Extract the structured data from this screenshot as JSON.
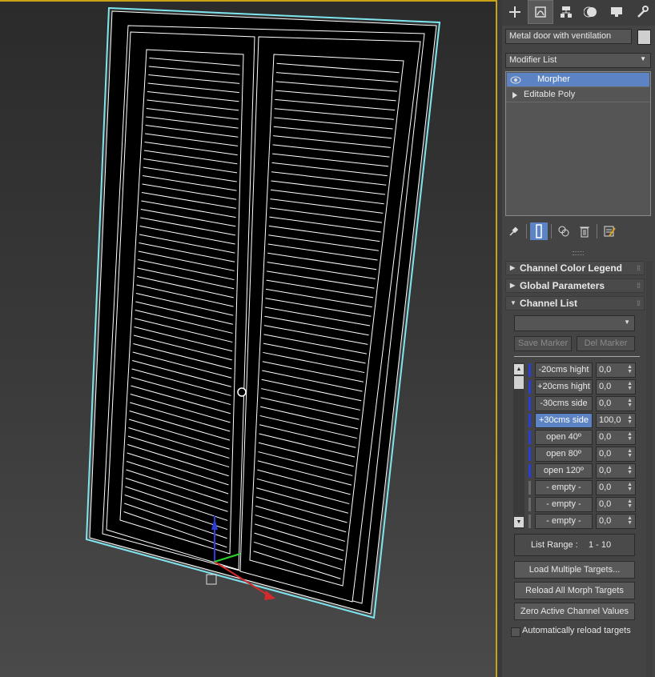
{
  "command_panel": {
    "tabs": [
      {
        "icon": "create-plus-icon"
      },
      {
        "icon": "modify-icon",
        "active": true
      },
      {
        "icon": "hierarchy-icon"
      },
      {
        "icon": "motion-icon"
      },
      {
        "icon": "display-icon"
      },
      {
        "icon": "utilities-wrench-icon"
      }
    ],
    "object_name": "Metal door with ventilation",
    "object_color": "#cfcfcf",
    "modifier_list_label": "Modifier List",
    "stack": [
      {
        "label": "Morpher",
        "selected": true
      },
      {
        "label": "Editable Poly",
        "selected": false
      }
    ],
    "rollouts": {
      "channel_color_legend": "Channel Color Legend",
      "global_parameters": "Global Parameters",
      "channel_list": "Channel List"
    },
    "marker_dropdown_value": "",
    "save_marker": "Save Marker",
    "del_marker": "Del Marker",
    "channels": [
      {
        "name": "-20cms hight",
        "value": "0,0",
        "color": "#2b3fd6",
        "selected": false
      },
      {
        "name": "+20cms hight",
        "value": "0,0",
        "color": "#2b3fd6",
        "selected": false
      },
      {
        "name": "-30cms side",
        "value": "0,0",
        "color": "#2b3fd6",
        "selected": false
      },
      {
        "name": "+30cms side",
        "value": "100,0",
        "color": "#2b3fd6",
        "selected": true
      },
      {
        "name": "open 40º",
        "value": "0,0",
        "color": "#2b3fd6",
        "selected": false
      },
      {
        "name": "open 80º",
        "value": "0,0",
        "color": "#2b3fd6",
        "selected": false
      },
      {
        "name": "open 120º",
        "value": "0,0",
        "color": "#2b3fd6",
        "selected": false
      },
      {
        "name": "- empty -",
        "value": "0,0",
        "color": "#6a6a6a",
        "selected": false
      },
      {
        "name": "- empty -",
        "value": "0,0",
        "color": "#6a6a6a",
        "selected": false
      },
      {
        "name": "- empty -",
        "value": "0,0",
        "color": "#6a6a6a",
        "selected": false
      }
    ],
    "list_range_label": "List Range :",
    "list_range_value": "1 - 10",
    "load_multiple_targets": "Load Multiple Targets...",
    "reload_all_morph_targets": "Reload All Morph Targets",
    "zero_active_channel_values": "Zero Active Channel Values",
    "auto_reload_label": "Automatically reload targets",
    "auto_reload_checked": false
  },
  "viewport": {
    "object": "door-shutter-wireframe",
    "selection_color": "#7fe6f0",
    "gizmo_axes": [
      "x",
      "y",
      "z"
    ]
  }
}
